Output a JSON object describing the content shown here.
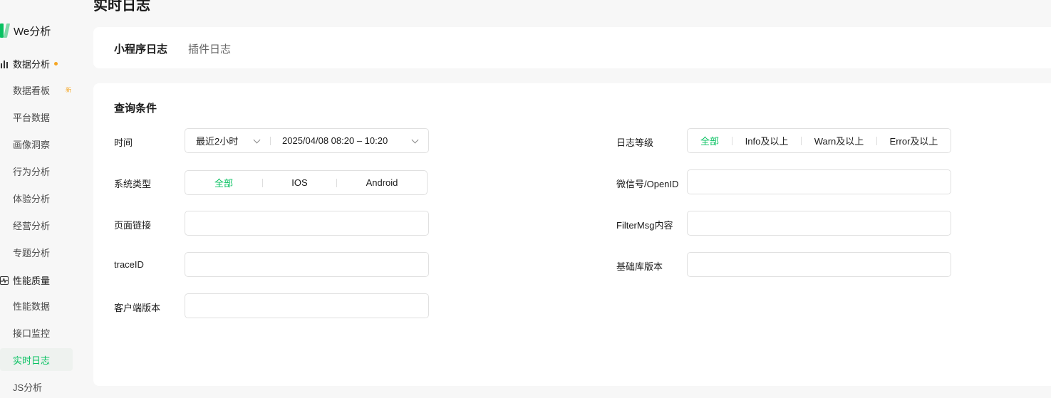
{
  "page": {
    "title": "实时日志"
  },
  "brand": {
    "name": "We分析"
  },
  "sidebar": {
    "groups": [
      {
        "label": "数据分析"
      },
      {
        "label": "性能质量"
      }
    ],
    "items": [
      {
        "label": "数据看板",
        "badge": "新"
      },
      {
        "label": "平台数据"
      },
      {
        "label": "画像洞察"
      },
      {
        "label": "行为分析"
      },
      {
        "label": "体验分析"
      },
      {
        "label": "经营分析"
      },
      {
        "label": "专题分析"
      },
      {
        "label": "性能数据"
      },
      {
        "label": "接口监控"
      },
      {
        "label": "实时日志"
      },
      {
        "label": "JS分析"
      }
    ]
  },
  "tabs": [
    {
      "label": "小程序日志"
    },
    {
      "label": "插件日志"
    }
  ],
  "query": {
    "title": "查询条件",
    "time": {
      "label": "时间",
      "preset": "最近2小时",
      "range": "2025/04/08 08:20 – 10:20"
    },
    "log_level": {
      "label": "日志等级",
      "options": [
        "全部",
        "Info及以上",
        "Warn及以上",
        "Error及以上"
      ],
      "selected": "全部"
    },
    "system_type": {
      "label": "系统类型",
      "options": [
        "全部",
        "IOS",
        "Android"
      ],
      "selected": "全部"
    },
    "wechat_id": {
      "label": "微信号/OpenID",
      "value": ""
    },
    "page_link": {
      "label": "页面链接",
      "value": ""
    },
    "filter_msg": {
      "label": "FilterMsg内容",
      "value": ""
    },
    "trace_id": {
      "label": "traceID",
      "value": ""
    },
    "lib_version": {
      "label": "基础库版本",
      "value": ""
    },
    "client_version": {
      "label": "客户端版本",
      "value": ""
    }
  },
  "colors": {
    "accent": "#07c160",
    "dot": "#f5a623"
  }
}
